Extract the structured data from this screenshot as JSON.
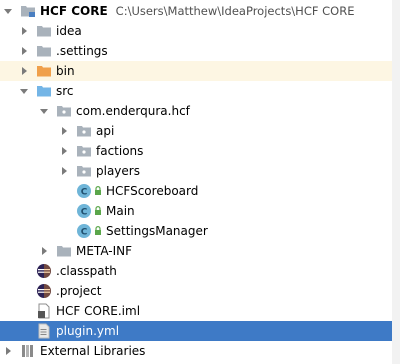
{
  "tree": {
    "root": {
      "name": "HCF CORE",
      "path": "C:\\Users\\Matthew\\IdeaProjects\\HCF CORE"
    },
    "idea": "idea",
    "settings": ".settings",
    "bin": "bin",
    "src": "src",
    "package": "com.enderqura.hcf",
    "api": "api",
    "factions": "factions",
    "players": "players",
    "class1": "HCFScoreboard",
    "class2": "Main",
    "class3": "SettingsManager",
    "metainf": "META-INF",
    "classpath": ".classpath",
    "project": ".project",
    "iml": "HCF CORE.iml",
    "pluginyml": "plugin.yml",
    "extlibs": "External Libraries"
  },
  "colors": {
    "selection": "#3e7ac6",
    "folder": "#a9b2bb",
    "folder_orange": "#f0a04b",
    "folder_src": "#74b5e6",
    "class_circle": "#6fb5d8",
    "lock_green": "#5aa64a"
  }
}
